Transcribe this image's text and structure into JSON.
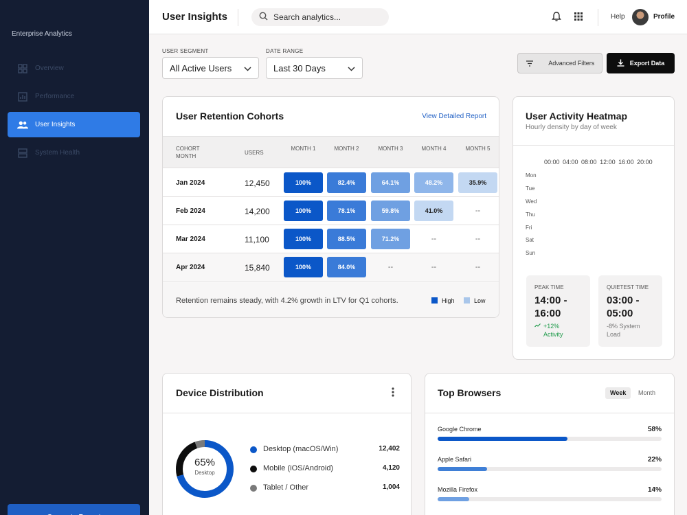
{
  "sidebar": {
    "brand": "Enterprise Analytics",
    "items": [
      {
        "label": "Overview",
        "icon": "grid-icon",
        "active": false
      },
      {
        "label": "Performance",
        "icon": "chart-icon",
        "active": false
      },
      {
        "label": "User Insights",
        "icon": "users-icon",
        "active": true
      },
      {
        "label": "System Health",
        "icon": "server-icon",
        "active": false
      }
    ],
    "generate_label": "Generate Report"
  },
  "header": {
    "title": "User Insights",
    "search_placeholder": "Search analytics...",
    "help": "Help",
    "profile": "Profile"
  },
  "filters": {
    "segment_label": "USER SEGMENT",
    "segment_value": "All Active Users",
    "range_label": "DATE RANGE",
    "range_value": "Last 30 Days",
    "advanced_label": "Advanced Filters",
    "export_label": "Export Data"
  },
  "retention": {
    "title": "User Retention Cohorts",
    "view_link": "View Detailed Report",
    "columns": {
      "cohort": "COHORT MONTH",
      "users": "USERS",
      "m1": "MONTH 1",
      "m2": "MONTH 2",
      "m3": "MONTH 3",
      "m4": "MONTH 4",
      "m5": "MONTH 5"
    },
    "rows": [
      {
        "cohort": "Jan 2024",
        "users": "12,450",
        "values": [
          100,
          82.4,
          64.1,
          48.2,
          35.9
        ],
        "labels": [
          "100%",
          "82.4%",
          "64.1%",
          "48.2%",
          "35.9%"
        ]
      },
      {
        "cohort": "Feb 2024",
        "users": "14,200",
        "values": [
          100,
          78.1,
          59.8,
          41.0,
          null
        ],
        "labels": [
          "100%",
          "78.1%",
          "59.8%",
          "41.0%",
          "--"
        ]
      },
      {
        "cohort": "Mar 2024",
        "users": "11,100",
        "values": [
          100,
          88.5,
          71.2,
          null,
          null
        ],
        "labels": [
          "100%",
          "88.5%",
          "71.2%",
          "--",
          "--"
        ]
      },
      {
        "cohort": "Apr 2024",
        "users": "15,840",
        "values": [
          100,
          84.0,
          null,
          null,
          null
        ],
        "labels": [
          "100%",
          "84.0%",
          "--",
          "--",
          "--"
        ]
      }
    ],
    "insight": "Retention remains steady, with 4.2% growth in LTV for Q1 cohorts.",
    "legend_high": "High",
    "legend_low": "Low",
    "color_high": "#0b57c8",
    "color_low": "#a9c6ea"
  },
  "heatmap": {
    "title": "User Activity Heatmap",
    "subtitle": "Hourly density by day of week",
    "hours": "00:00 04:00 08:00 12:00 16:00 20:00",
    "days": [
      "Mon",
      "Tue",
      "Wed",
      "Thu",
      "Fri",
      "Sat",
      "Sun"
    ],
    "peak": {
      "label": "PEAK TIME",
      "value": "14:00 - 16:00",
      "note": "+12% Activity"
    },
    "quiet": {
      "label": "QUIETEST TIME",
      "value": "03:00 - 05:00",
      "note": "-8% System Load"
    }
  },
  "device": {
    "title": "Device Distribution",
    "center_value": "65%",
    "center_label": "Desktop",
    "items": [
      {
        "name": "Desktop (macOS/Win)",
        "count": "12,402",
        "color": "#0b57c8"
      },
      {
        "name": "Mobile (iOS/Android)",
        "count": "4,120",
        "color": "#0d0d0d"
      },
      {
        "name": "Tablet / Other",
        "count": "1,004",
        "color": "#7a7a7a"
      }
    ]
  },
  "browsers": {
    "title": "Top Browsers",
    "week": "Week",
    "month": "Month",
    "items": [
      {
        "name": "Google Chrome",
        "pct_label": "58%",
        "value": 58,
        "color": "#0b57c8"
      },
      {
        "name": "Apple Safari",
        "pct_label": "22%",
        "value": 22,
        "color": "#3f7fd6"
      },
      {
        "name": "Mozilla Firefox",
        "pct_label": "14%",
        "value": 14,
        "color": "#6fa0e2"
      }
    ]
  }
}
